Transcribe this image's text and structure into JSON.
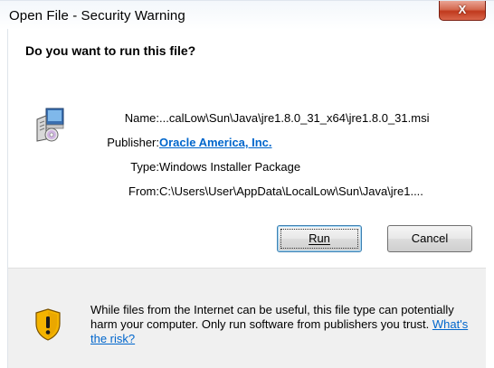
{
  "window": {
    "title": "Open File - Security Warning",
    "close_glyph": "X"
  },
  "dialog": {
    "heading": "Do you want to run this file?",
    "fields": {
      "name_label": "Name:",
      "name_value": "...calLow\\Sun\\Java\\jre1.8.0_31_x64\\jre1.8.0_31.msi",
      "publisher_label": "Publisher:",
      "publisher_value": "Oracle America, Inc.",
      "type_label": "Type:",
      "type_value": "Windows Installer Package",
      "from_label": "From:",
      "from_value": "C:\\Users\\User\\AppData\\LocalLow\\Sun\\Java\\jre1...."
    },
    "buttons": {
      "run_label": "Run",
      "cancel_label": "Cancel"
    }
  },
  "footer": {
    "warning_text": "While files from the Internet can be useful, this file type can potentially harm your computer. Only run software from publishers you trust.",
    "risk_link": "What's the risk?"
  },
  "icons": {
    "file": "installer-package-icon",
    "footer": "warning-shield-icon"
  },
  "colors": {
    "link": "#0066cc",
    "close_button": "#c0391d",
    "footer_bg": "#f0f0f0"
  }
}
